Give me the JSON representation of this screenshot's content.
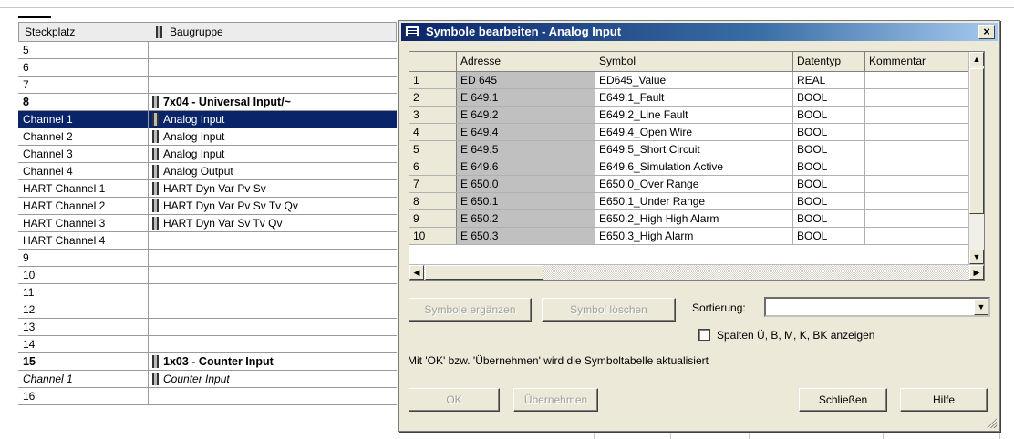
{
  "background_table": {
    "headers": {
      "slot": "Steckplatz",
      "module": "Baugruppe"
    },
    "rows": [
      {
        "slot": "5",
        "module": "",
        "style": ""
      },
      {
        "slot": "6",
        "module": "",
        "style": ""
      },
      {
        "slot": "7",
        "module": "",
        "style": ""
      },
      {
        "slot": "8",
        "module": "7x04 - Universal Input/~",
        "style": "bold",
        "icon": true
      },
      {
        "slot": "Channel 1",
        "module": "Analog Input",
        "style": "sel",
        "icon": true
      },
      {
        "slot": "Channel 2",
        "module": "Analog Input",
        "style": "",
        "icon": true
      },
      {
        "slot": "Channel 3",
        "module": "Analog Input",
        "style": "",
        "icon": true
      },
      {
        "slot": "Channel 4",
        "module": "Analog Output",
        "style": "",
        "icon": true
      },
      {
        "slot": "HART Channel 1",
        "module": "HART Dyn Var Pv Sv",
        "style": "",
        "icon": true
      },
      {
        "slot": "HART Channel 2",
        "module": "HART Dyn Var Pv Sv Tv Qv",
        "style": "",
        "icon": true
      },
      {
        "slot": "HART Channel 3",
        "module": "HART Dyn Var Sv Tv Qv",
        "style": "",
        "icon": true
      },
      {
        "slot": "HART Channel 4",
        "module": "",
        "style": ""
      },
      {
        "slot": "9",
        "module": "",
        "style": ""
      },
      {
        "slot": "10",
        "module": "",
        "style": ""
      },
      {
        "slot": "11",
        "module": "",
        "style": ""
      },
      {
        "slot": "12",
        "module": "",
        "style": ""
      },
      {
        "slot": "13",
        "module": "",
        "style": ""
      },
      {
        "slot": "14",
        "module": "",
        "style": ""
      },
      {
        "slot": "15",
        "module": "1x03 - Counter Input",
        "style": "bold",
        "icon": true
      },
      {
        "slot": "Channel 1",
        "module": "Counter Input",
        "style": "italic",
        "icon": true
      },
      {
        "slot": "16",
        "module": "",
        "style": ""
      }
    ]
  },
  "dialog": {
    "title": "Symbole bearbeiten - Analog Input",
    "close_label": "×",
    "columns": {
      "num": "",
      "address": "Adresse",
      "symbol": "Symbol",
      "type": "Datentyp",
      "comment": "Kommentar"
    },
    "rows": [
      {
        "num": "1",
        "address": "ED   645",
        "symbol": "ED645_Value",
        "type": "REAL",
        "comment": ""
      },
      {
        "num": "2",
        "address": "E    649.1",
        "symbol": "E649.1_Fault",
        "type": "BOOL",
        "comment": ""
      },
      {
        "num": "3",
        "address": "E    649.2",
        "symbol": "E649.2_Line Fault",
        "type": "BOOL",
        "comment": ""
      },
      {
        "num": "4",
        "address": "E    649.4",
        "symbol": "E649.4_Open Wire",
        "type": "BOOL",
        "comment": ""
      },
      {
        "num": "5",
        "address": "E    649.5",
        "symbol": "E649.5_Short Circuit",
        "type": "BOOL",
        "comment": ""
      },
      {
        "num": "6",
        "address": "E    649.6",
        "symbol": "E649.6_Simulation Active",
        "type": "BOOL",
        "comment": ""
      },
      {
        "num": "7",
        "address": "E    650.0",
        "symbol": "E650.0_Over Range",
        "type": "BOOL",
        "comment": ""
      },
      {
        "num": "8",
        "address": "E    650.1",
        "symbol": "E650.1_Under Range",
        "type": "BOOL",
        "comment": ""
      },
      {
        "num": "9",
        "address": "E    650.2",
        "symbol": "E650.2_High High Alarm",
        "type": "BOOL",
        "comment": ""
      },
      {
        "num": "10",
        "address": "E    650.3",
        "symbol": "E650.3_High Alarm",
        "type": "BOOL",
        "comment": ""
      }
    ],
    "buttons": {
      "add_symbols": "Symbole ergänzen",
      "delete_symbol": "Symbol löschen",
      "ok": "OK",
      "apply": "Übernehmen",
      "close": "Schließen",
      "help": "Hilfe"
    },
    "sort_label": "Sortierung:",
    "sort_value": "",
    "checkbox_label": "Spalten Ü, B, M, K, BK anzeigen",
    "checkbox_checked": false,
    "info_text": "Mit 'OK' bzw. 'Übernehmen' wird die Symboltabelle aktualisiert",
    "scroll_icons": {
      "up": "arrow-up-icon",
      "down": "arrow-down-icon",
      "left": "arrow-left-icon",
      "right": "arrow-right-icon"
    }
  },
  "colors": {
    "title_start": "#0a246a",
    "title_end": "#a6caf0",
    "selection": "#0a246a",
    "dialog_bg": "#ece9d8"
  }
}
